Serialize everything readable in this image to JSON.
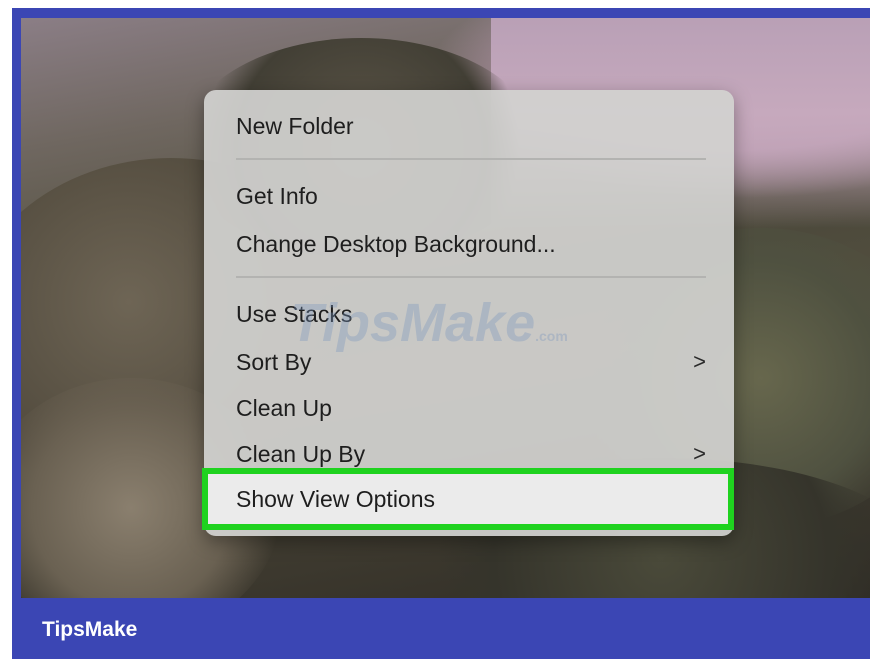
{
  "colors": {
    "frame": "#3b46b4",
    "menu_bg": "#d2d2d0",
    "highlight_border": "#1fd21f",
    "text": "#1e1e1e"
  },
  "branding": {
    "footer_text": "TipsMake",
    "watermark": "TipsMake",
    "watermark_suffix": ".com"
  },
  "context_menu": {
    "groups": [
      {
        "items": [
          {
            "label": "New Folder"
          }
        ]
      },
      {
        "items": [
          {
            "label": "Get Info"
          },
          {
            "label": "Change Desktop Background..."
          }
        ]
      },
      {
        "items": [
          {
            "label": "Use Stacks"
          },
          {
            "label": "Sort By",
            "submenu_icon": "chevron-right-icon",
            "chevron": ">"
          },
          {
            "label": "Clean Up"
          },
          {
            "label": "Clean Up By",
            "submenu_icon": "chevron-right-icon",
            "chevron": ">"
          },
          {
            "label": "Show View Options",
            "highlighted": true
          }
        ]
      }
    ]
  }
}
